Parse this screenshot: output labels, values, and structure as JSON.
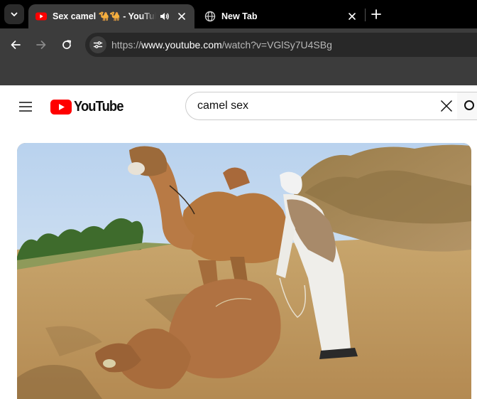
{
  "browser": {
    "tabs": [
      {
        "title": "Sex camel 🐪🐪 - YouTube",
        "active": true,
        "audio": true
      },
      {
        "title": "New Tab",
        "active": false,
        "audio": false
      }
    ],
    "address_bar": {
      "url_scheme": "https://",
      "url_host": "www.youtube.com",
      "url_path": "/watch?v=VGlSy7U4SBg"
    },
    "colors": {
      "tabstrip": "#000000",
      "toolbar": "#3c3c3c",
      "omnibox": "#282828"
    }
  },
  "youtube": {
    "logo_text": "YouTube",
    "search": {
      "query": "camel sex"
    },
    "colors": {
      "brand_red": "#ff0000",
      "text": "#0f0f0f"
    }
  },
  "video": {
    "scene": "camel-and-herder-in-desert"
  },
  "icons": [
    "tab-list-chevron-icon",
    "youtube-favicon-icon",
    "audio-playing-icon",
    "close-icon",
    "globe-icon",
    "plus-icon",
    "back-arrow-icon",
    "forward-arrow-icon",
    "reload-icon",
    "site-info-icon",
    "hamburger-icon",
    "youtube-logo-icon",
    "clear-icon",
    "search-icon"
  ]
}
